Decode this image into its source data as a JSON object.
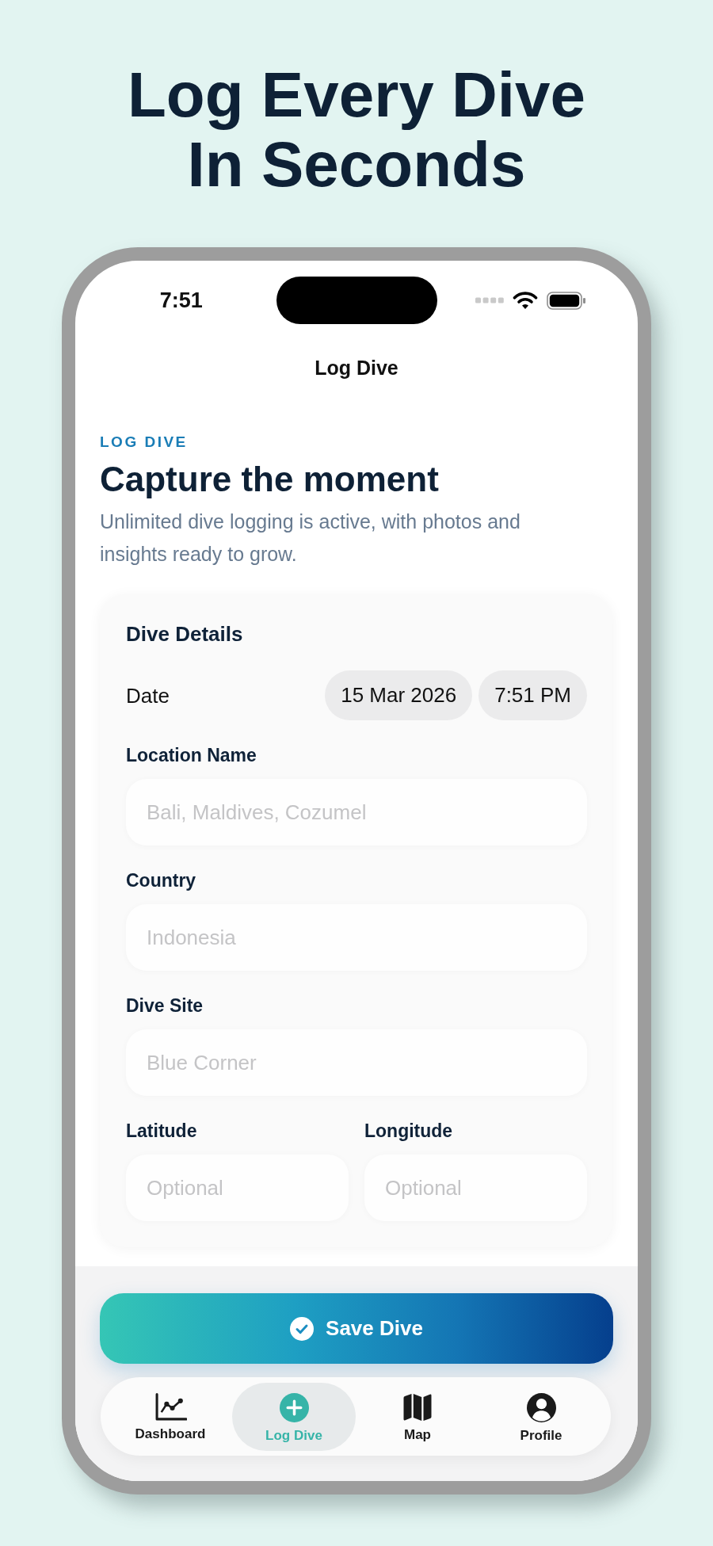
{
  "headline": {
    "text": "Log Every Dive In Seconds"
  },
  "status_bar": {
    "time": "7:51"
  },
  "nav": {
    "title": "Log Dive"
  },
  "header": {
    "eyebrow": "LOG DIVE",
    "title": "Capture the moment",
    "subtitle": "Unlimited dive logging is active, with photos and insights ready to grow."
  },
  "form": {
    "title": "Dive Details",
    "date": {
      "label": "Date",
      "date": "15 Mar 2026",
      "time": "7:51 PM"
    },
    "fields": [
      {
        "label": "Location Name",
        "placeholder": "Bali, Maldives, Cozumel"
      },
      {
        "label": "Country",
        "placeholder": "Indonesia"
      },
      {
        "label": "Dive Site",
        "placeholder": "Blue Corner"
      }
    ],
    "coordinates": [
      {
        "label": "Latitude",
        "placeholder": "Optional"
      },
      {
        "label": "Longitude",
        "placeholder": "Optional"
      }
    ]
  },
  "save_button": {
    "label": "Save Dive"
  },
  "tab_bar": {
    "tabs": [
      {
        "label": "Dashboard",
        "selected": false
      },
      {
        "label": "Log Dive",
        "selected": true
      },
      {
        "label": "Map",
        "selected": false
      },
      {
        "label": "Profile",
        "selected": false
      }
    ]
  }
}
